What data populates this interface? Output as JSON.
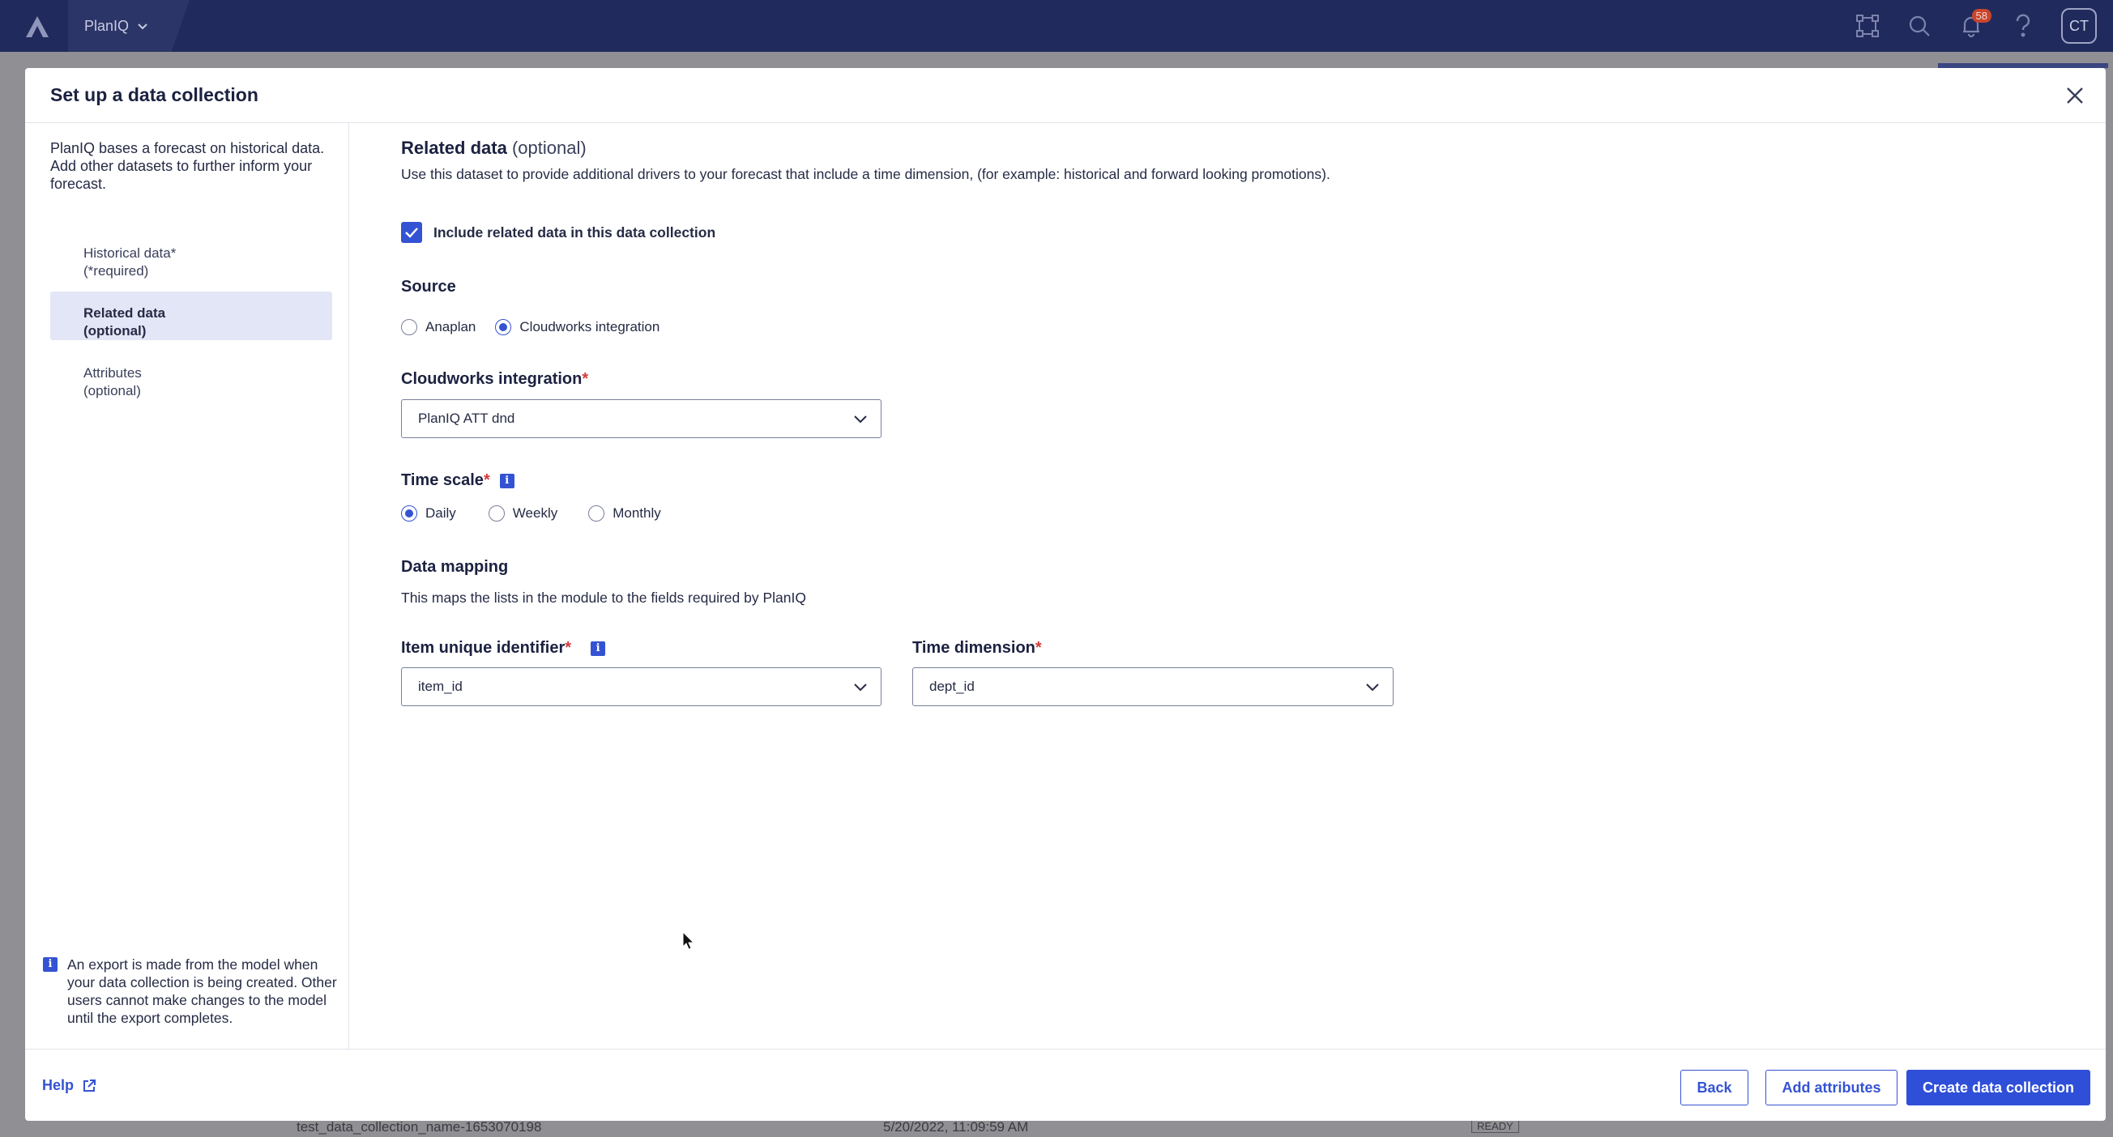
{
  "topbar": {
    "app_name": "PlanIQ",
    "notification_count": "58",
    "avatar_initials": "CT"
  },
  "background_row": {
    "name": "test_data_collection_name-1653070198",
    "date": "5/20/2022, 11:09:59 AM",
    "status": "READY"
  },
  "modal": {
    "title": "Set up a data collection",
    "sidebar": {
      "intro": "PlanIQ bases a forecast on historical data. Add other datasets to further inform your forecast.",
      "steps": [
        {
          "line1": "Historical data*",
          "line2": "(*required)"
        },
        {
          "line1": "Related data",
          "line2": "(optional)"
        },
        {
          "line1": "Attributes",
          "line2": "(optional)"
        }
      ],
      "note": "An export is made from the model when your data collection is being created. Other users cannot make changes to the model until the export completes."
    },
    "main": {
      "title": "Related data",
      "title_optional": "(optional)",
      "description": "Use this dataset to provide additional drivers to your forecast that include a time dimension, (for example: historical and forward looking promotions).",
      "include_checkbox_label": "Include related data in this data collection",
      "source": {
        "label": "Source",
        "options": [
          "Anaplan",
          "Cloudworks integration"
        ],
        "selected": "Cloudworks integration"
      },
      "cloudworks": {
        "label": "Cloudworks integration",
        "required_mark": "*",
        "value": "PlanIQ ATT dnd"
      },
      "time_scale": {
        "label": "Time scale",
        "required_mark": "*",
        "options": [
          "Daily",
          "Weekly",
          "Monthly"
        ],
        "selected": "Daily"
      },
      "data_mapping": {
        "label": "Data mapping",
        "description": "This maps the lists in the module to the fields required by PlanIQ"
      },
      "item_identifier": {
        "label": "Item unique identifier",
        "required_mark": "*",
        "value": "item_id"
      },
      "time_dimension": {
        "label": "Time dimension",
        "required_mark": "*",
        "value": "dept_id"
      }
    },
    "footer": {
      "help": "Help",
      "back": "Back",
      "add_attributes": "Add attributes",
      "create": "Create data collection"
    }
  },
  "colors": {
    "accent": "#3453d3",
    "nav_bg": "#202a5c",
    "required": "#d63a3a",
    "active_step_bg": "#e3e6f6"
  }
}
